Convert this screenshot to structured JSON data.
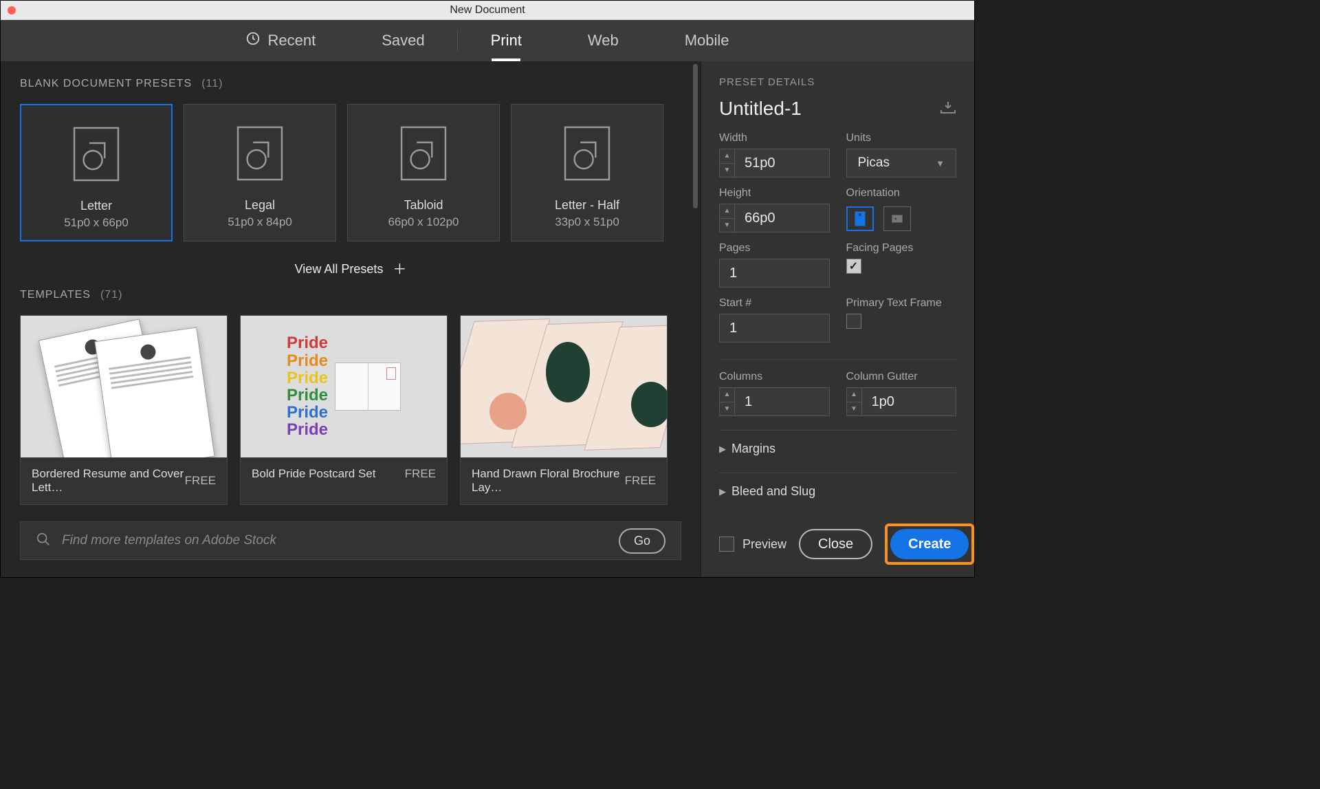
{
  "titlebar": {
    "title": "New Document"
  },
  "tabs": {
    "recent": "Recent",
    "saved": "Saved",
    "print": "Print",
    "web": "Web",
    "mobile": "Mobile"
  },
  "sections": {
    "presets_label": "BLANK DOCUMENT PRESETS",
    "presets_count": "(11)",
    "templates_label": "TEMPLATES",
    "templates_count": "(71)",
    "view_all": "View All Presets"
  },
  "presets": [
    {
      "name": "Letter",
      "dim": "51p0 x 66p0"
    },
    {
      "name": "Legal",
      "dim": "51p0 x 84p0"
    },
    {
      "name": "Tabloid",
      "dim": "66p0 x 102p0"
    },
    {
      "name": "Letter - Half",
      "dim": "33p0 x 51p0"
    }
  ],
  "templates": [
    {
      "name": "Bordered Resume and Cover Lett…",
      "price": "FREE"
    },
    {
      "name": "Bold Pride Postcard Set",
      "price": "FREE"
    },
    {
      "name": "Hand Drawn Floral Brochure Lay…",
      "price": "FREE"
    }
  ],
  "search": {
    "placeholder": "Find more templates on Adobe Stock",
    "go": "Go"
  },
  "details": {
    "heading": "PRESET DETAILS",
    "docname": "Untitled-1",
    "width_label": "Width",
    "width": "51p0",
    "units_label": "Units",
    "units": "Picas",
    "height_label": "Height",
    "height": "66p0",
    "orientation_label": "Orientation",
    "pages_label": "Pages",
    "pages": "1",
    "facing_label": "Facing Pages",
    "start_label": "Start #",
    "start": "1",
    "ptf_label": "Primary Text Frame",
    "columns_label": "Columns",
    "columns": "1",
    "gutter_label": "Column Gutter",
    "gutter": "1p0",
    "margins": "Margins",
    "bleed": "Bleed and Slug"
  },
  "footer": {
    "preview": "Preview",
    "close": "Close",
    "create": "Create"
  },
  "pride_word": "Pride"
}
